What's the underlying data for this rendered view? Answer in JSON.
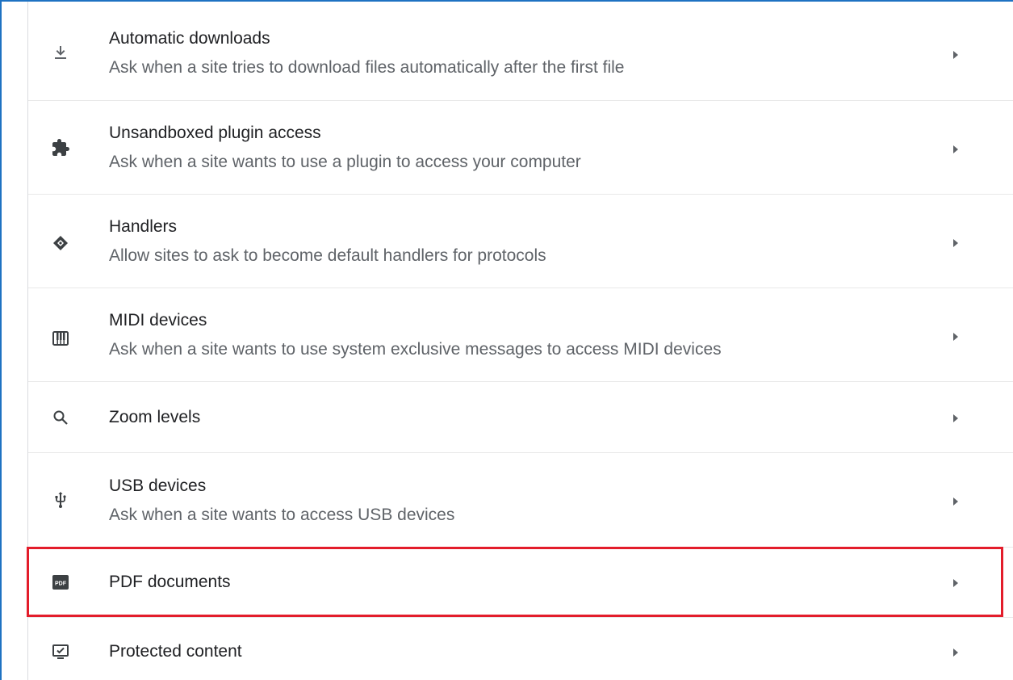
{
  "settings_list": {
    "items": [
      {
        "title": "Automatic downloads",
        "subtitle": "Ask when a site tries to download files automatically after the first file",
        "icon": "download-icon"
      },
      {
        "title": "Unsandboxed plugin access",
        "subtitle": "Ask when a site wants to use a plugin to access your computer",
        "icon": "puzzle-piece-icon"
      },
      {
        "title": "Handlers",
        "subtitle": "Allow sites to ask to become default handlers for protocols",
        "icon": "handlers-diamond-icon"
      },
      {
        "title": "MIDI devices",
        "subtitle": "Ask when a site wants to use system exclusive messages to access MIDI devices",
        "icon": "piano-keys-icon"
      },
      {
        "title": "Zoom levels",
        "subtitle": "",
        "icon": "search-icon"
      },
      {
        "title": "USB devices",
        "subtitle": "Ask when a site wants to access USB devices",
        "icon": "usb-icon"
      },
      {
        "title": "PDF documents",
        "subtitle": "",
        "icon": "pdf-icon",
        "icon_text": "PDF"
      },
      {
        "title": "Protected content",
        "subtitle": "",
        "icon": "monitor-check-icon"
      }
    ]
  },
  "colors": {
    "window_border": "#1e72c2",
    "highlight_border": "#e31d2b",
    "title_text": "#202124",
    "subtitle_text": "#5f6368",
    "icon": "#5f6368"
  }
}
